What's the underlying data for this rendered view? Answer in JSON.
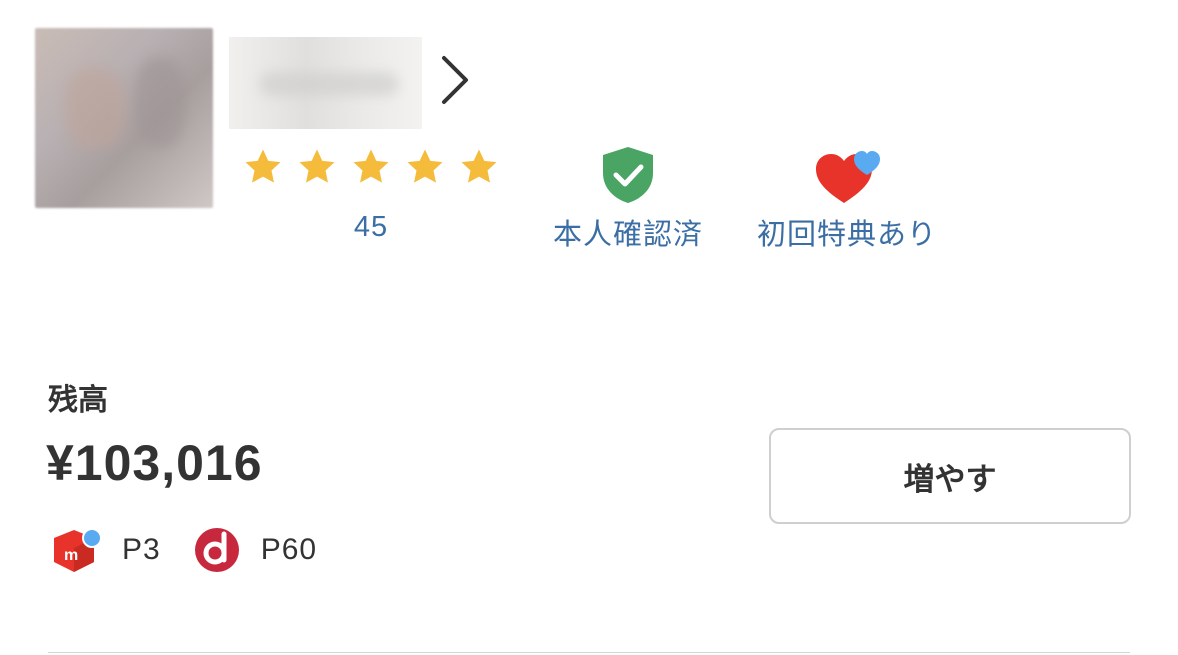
{
  "profile": {
    "rating_count": "45",
    "stars_filled": 5,
    "stars_total": 5,
    "badges": {
      "verified_label": "本人確認済",
      "first_time_label": "初回特典あり"
    }
  },
  "balance": {
    "label": "残高",
    "amount": "¥103,016",
    "add_button_label": "増やす",
    "points": [
      {
        "icon": "merpay-icon",
        "label": "P3"
      },
      {
        "icon": "d-point-icon",
        "label": "P60"
      }
    ]
  },
  "colors": {
    "star": "#f5bb3b",
    "link_blue": "#3a6ea5",
    "verified_green": "#4aa463",
    "heart_red": "#e8332a",
    "heart_blue": "#5aaaf2",
    "merpay_red": "#e8332a",
    "dpoint_red": "#c8283d"
  }
}
